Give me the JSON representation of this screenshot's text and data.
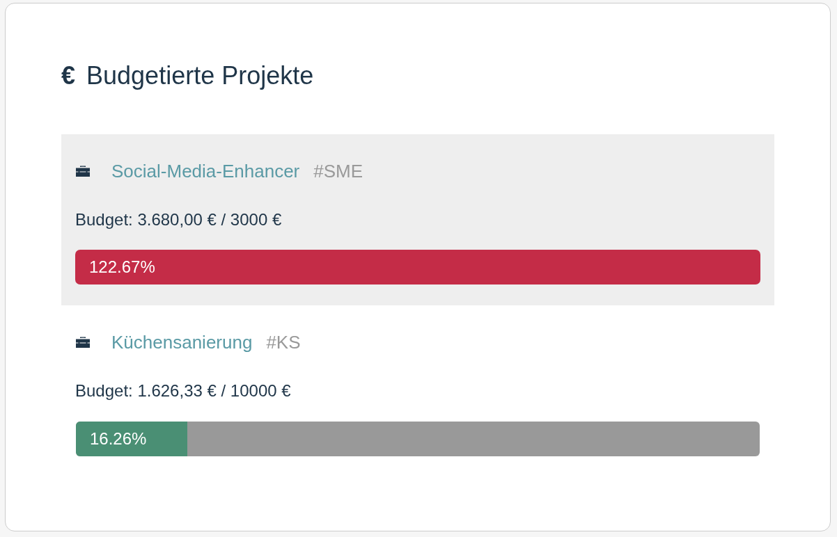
{
  "title": {
    "icon": "€",
    "text": "Budgetierte Projekte"
  },
  "projects": [
    {
      "name": "Social-Media-Enhancer",
      "code": "#SME",
      "budget": "Budget: 3.680,00 € / 3000 €",
      "percent": "122.67%",
      "kind": "exceeded",
      "color": "#c42c47",
      "selected": true
    },
    {
      "name": "Küchensanierung",
      "code": "#KS",
      "budget": "Budget: 1.626,33 € / 10000 €",
      "percent": "16.26%",
      "kind": "progress",
      "level": 0.1626,
      "color": "#4a8f74",
      "selected": false
    }
  ]
}
